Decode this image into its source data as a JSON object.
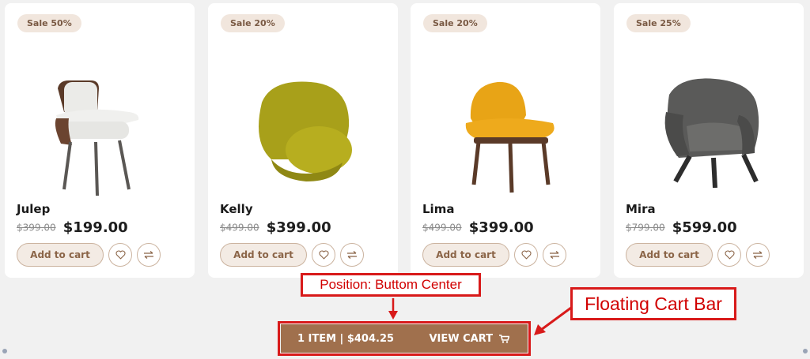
{
  "products": [
    {
      "badge": "Sale 50%",
      "name": "Julep",
      "old_price": "$399.00",
      "price": "$199.00",
      "add_label": "Add to cart"
    },
    {
      "badge": "Sale 20%",
      "name": "Kelly",
      "old_price": "$499.00",
      "price": "$399.00",
      "add_label": "Add to cart"
    },
    {
      "badge": "Sale 20%",
      "name": "Lima",
      "old_price": "$499.00",
      "price": "$399.00",
      "add_label": "Add to cart"
    },
    {
      "badge": "Sale 25%",
      "name": "Mira",
      "old_price": "$799.00",
      "price": "$599.00",
      "add_label": "Add to cart"
    }
  ],
  "cart_bar": {
    "summary": "1 ITEM | $404.25",
    "view_label": "VIEW CART"
  },
  "annotations": {
    "position": "Position: Buttom Center",
    "title": "Floating Cart Bar"
  },
  "colors": {
    "accent": "#a0704d",
    "badge_bg": "#f1e6dd",
    "annotation": "#d81a1a"
  },
  "icons": [
    "heart-icon",
    "compare-icon",
    "cart-icon"
  ]
}
